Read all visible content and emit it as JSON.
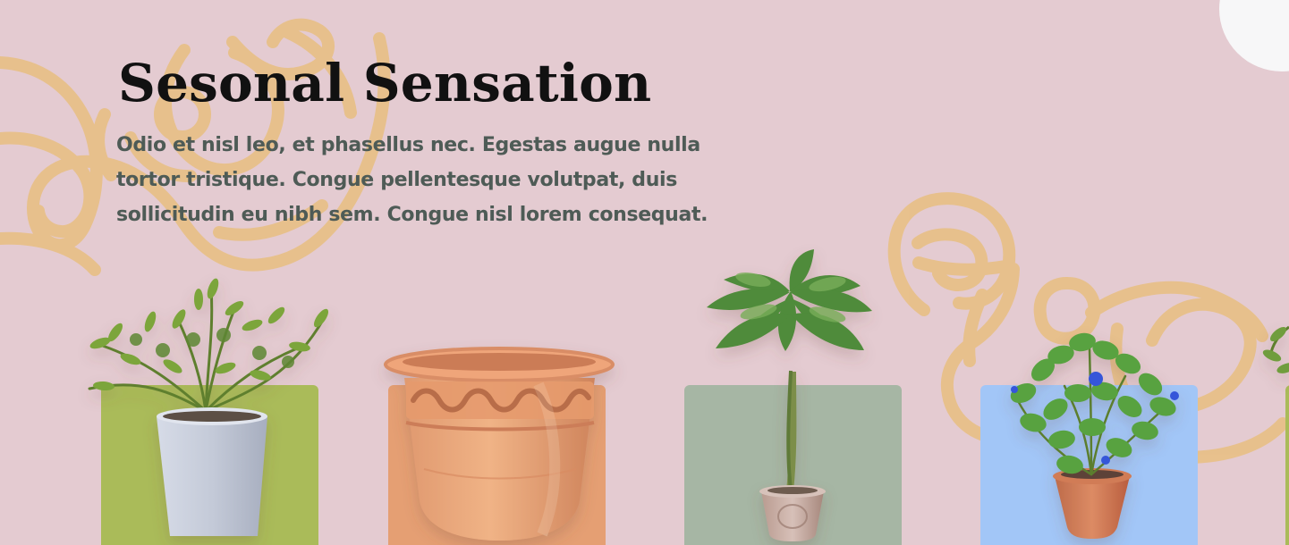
{
  "section": {
    "title": "Sesonal Sensation",
    "description": "Odio et nisl leo, et phasellus nec. Egestas augue nulla tortor tristique. Congue pellentesque volutpat, duis sollicitudin eu nibh sem. Congue nisl lorem consequat."
  },
  "theme": {
    "background": "#e4cbd1",
    "decor_stroke": "#e8c089",
    "corner_circle": "#f7f7f8",
    "headline": "#111111",
    "body_text": "#4e5b56"
  },
  "products": [
    {
      "image": "herb-plant-in-gray-pot",
      "card_color": "#aabb59"
    },
    {
      "image": "terracotta-pot",
      "card_color": "#e59f73"
    },
    {
      "image": "money-tree-in-ceramic-pot",
      "card_color": "#a6b6a4"
    },
    {
      "image": "flowering-plant-in-clay-pot",
      "card_color": "#a2c6f7"
    },
    {
      "image": "partial-plant-card",
      "card_color": "#aabb59"
    }
  ]
}
